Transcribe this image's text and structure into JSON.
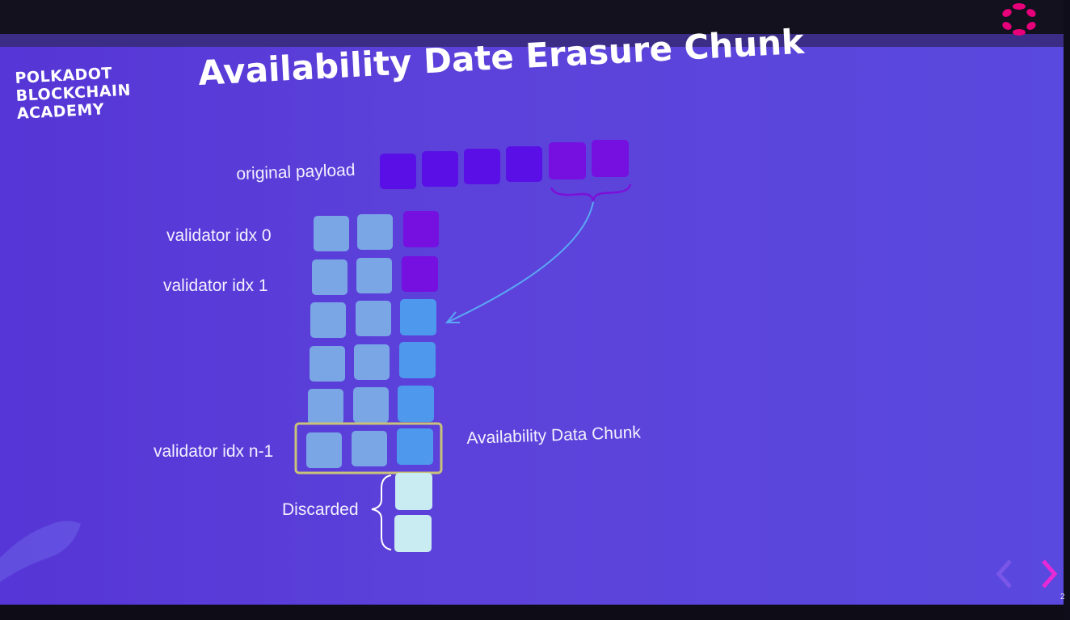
{
  "header": {
    "academy_lines": [
      "POLKADOT",
      "BLOCKCHAIN",
      "ACADEMY"
    ],
    "title": "Availability Date Erasure Chunk"
  },
  "labels": {
    "original_payload": "original payload",
    "validator_0": "validator idx 0",
    "validator_1": "validator idx 1",
    "validator_n1": "validator idx n-1",
    "availability_chunk": "Availability Data Chunk",
    "discarded": "Discarded"
  },
  "colors": {
    "payload": "#5a0fe6",
    "payload_highlight": "#7610e0",
    "data_cell": "#7aa6e6",
    "parity_cell": "#4e98ee",
    "discarded_cell": "#c8ecf1",
    "highlight_box": "#c9c27a",
    "accent_pink": "#e6007a"
  },
  "navigation": {
    "prev_icon": "chevron-left-icon",
    "next_icon": "chevron-right-icon"
  },
  "page_number": "2"
}
